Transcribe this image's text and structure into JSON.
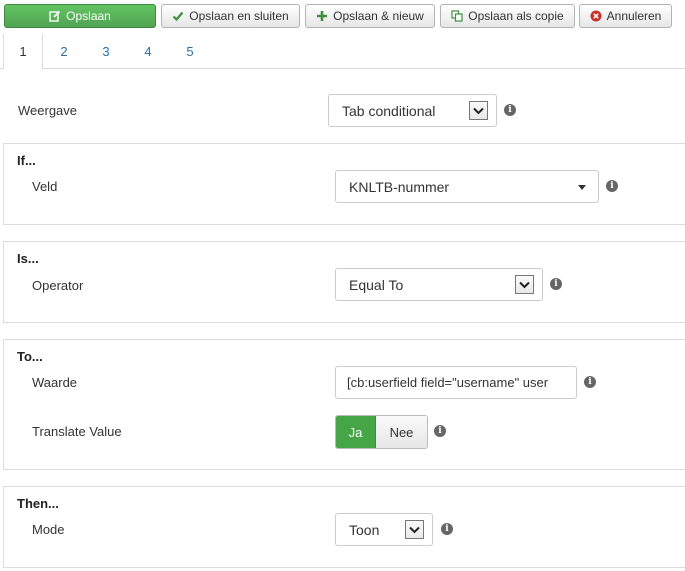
{
  "toolbar": {
    "save": "Opslaan",
    "save_close": "Opslaan en sluiten",
    "save_new": "Opslaan & nieuw",
    "save_copy": "Opslaan als copie",
    "cancel": "Annuleren"
  },
  "tabs": [
    "1",
    "2",
    "3",
    "4",
    "5"
  ],
  "weergave": {
    "label": "Weergave",
    "value": "Tab conditional"
  },
  "if_section": {
    "title": "If...",
    "veld_label": "Veld",
    "veld_value": "KNLTB-nummer"
  },
  "is_section": {
    "title": "Is...",
    "operator_label": "Operator",
    "operator_value": "Equal To"
  },
  "to_section": {
    "title": "To...",
    "waarde_label": "Waarde",
    "waarde_value": "[cb:userfield field=\"username\" user",
    "translate_label": "Translate Value",
    "yes": "Ja",
    "no": "Nee"
  },
  "then_section": {
    "title": "Then...",
    "mode_label": "Mode",
    "mode_value": "Toon"
  },
  "colors": {
    "success": "#51a351",
    "link": "#2a6fa8",
    "danger": "#c9302c"
  }
}
